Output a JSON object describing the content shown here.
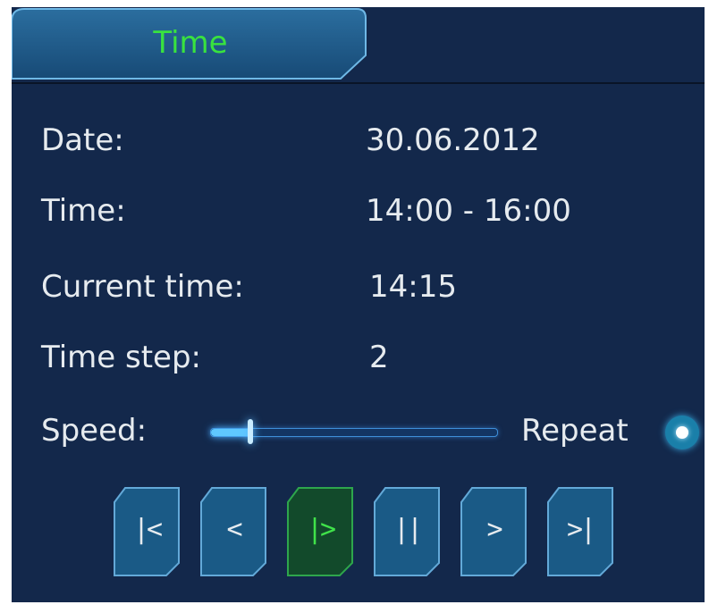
{
  "tab": {
    "label": "Time"
  },
  "rows": [
    {
      "label": "Date:",
      "value": "30.06.2012"
    },
    {
      "label": "Time:",
      "value": "14:00 - 16:00"
    },
    {
      "label": "Current time:",
      "value": "14:15"
    },
    {
      "label": "Time step:",
      "value": "2"
    }
  ],
  "speed": {
    "label": "Speed:",
    "level": 0.14
  },
  "repeat": {
    "label": "Repeat",
    "enabled": true
  },
  "controls": [
    {
      "glyph": "|<",
      "icon": "skip-to-start-icon",
      "active": false
    },
    {
      "glyph": "<",
      "icon": "step-back-icon",
      "active": false
    },
    {
      "glyph": "|>",
      "icon": "play-icon",
      "active": true
    },
    {
      "glyph": "||",
      "icon": "pause-icon",
      "active": false
    },
    {
      "glyph": ">",
      "icon": "step-forward-icon",
      "active": false
    },
    {
      "glyph": ">|",
      "icon": "skip-to-end-icon",
      "active": false
    }
  ],
  "colors": {
    "panel": "#13284b",
    "tab_label": "#39e23f",
    "text": "#e6ebef",
    "button_fill": "#1a5a86",
    "button_active_fill": "#124a2b",
    "button_active_border": "#2ea64c",
    "accent": "#5fc8ff"
  }
}
